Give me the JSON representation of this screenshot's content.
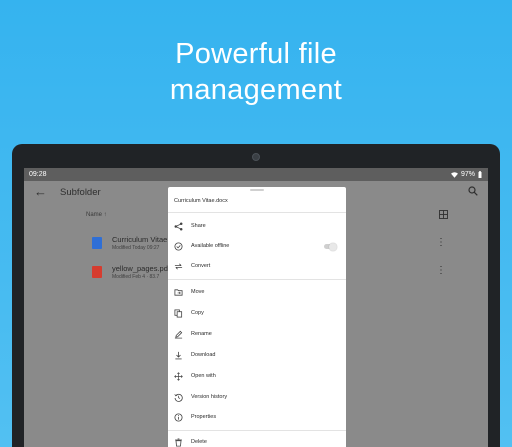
{
  "banner": {
    "line1": "Powerful file",
    "line2": "management"
  },
  "status": {
    "time": "09:28",
    "battery": "97%"
  },
  "toolbar": {
    "title": "Subfolder"
  },
  "list": {
    "sort_label": "Name ↑",
    "files": [
      {
        "name": "Curriculum Vitae",
        "meta": "Modified Today 09:27",
        "type": "doc",
        "color": "#2f6fd6"
      },
      {
        "name": "yellow_pages.pdf",
        "meta": "Modified Feb 4 · 83.7",
        "type": "pdf",
        "color": "#d63c2f"
      }
    ]
  },
  "sheet": {
    "title": "Curriculum Vitae.docx",
    "group1": [
      {
        "label": "Share",
        "icon": "share-icon"
      },
      {
        "label": "Available offline",
        "icon": "offline-icon",
        "toggle": false
      },
      {
        "label": "Convert",
        "icon": "convert-icon"
      }
    ],
    "group2": [
      {
        "label": "Move",
        "icon": "move-icon"
      },
      {
        "label": "Copy",
        "icon": "copy-icon"
      },
      {
        "label": "Rename",
        "icon": "rename-icon"
      },
      {
        "label": "Download",
        "icon": "download-icon"
      },
      {
        "label": "Open with",
        "icon": "open-with-icon"
      },
      {
        "label": "Version history",
        "icon": "history-icon"
      },
      {
        "label": "Properties",
        "icon": "info-icon"
      }
    ],
    "group3": [
      {
        "label": "Delete",
        "icon": "delete-icon"
      }
    ]
  }
}
